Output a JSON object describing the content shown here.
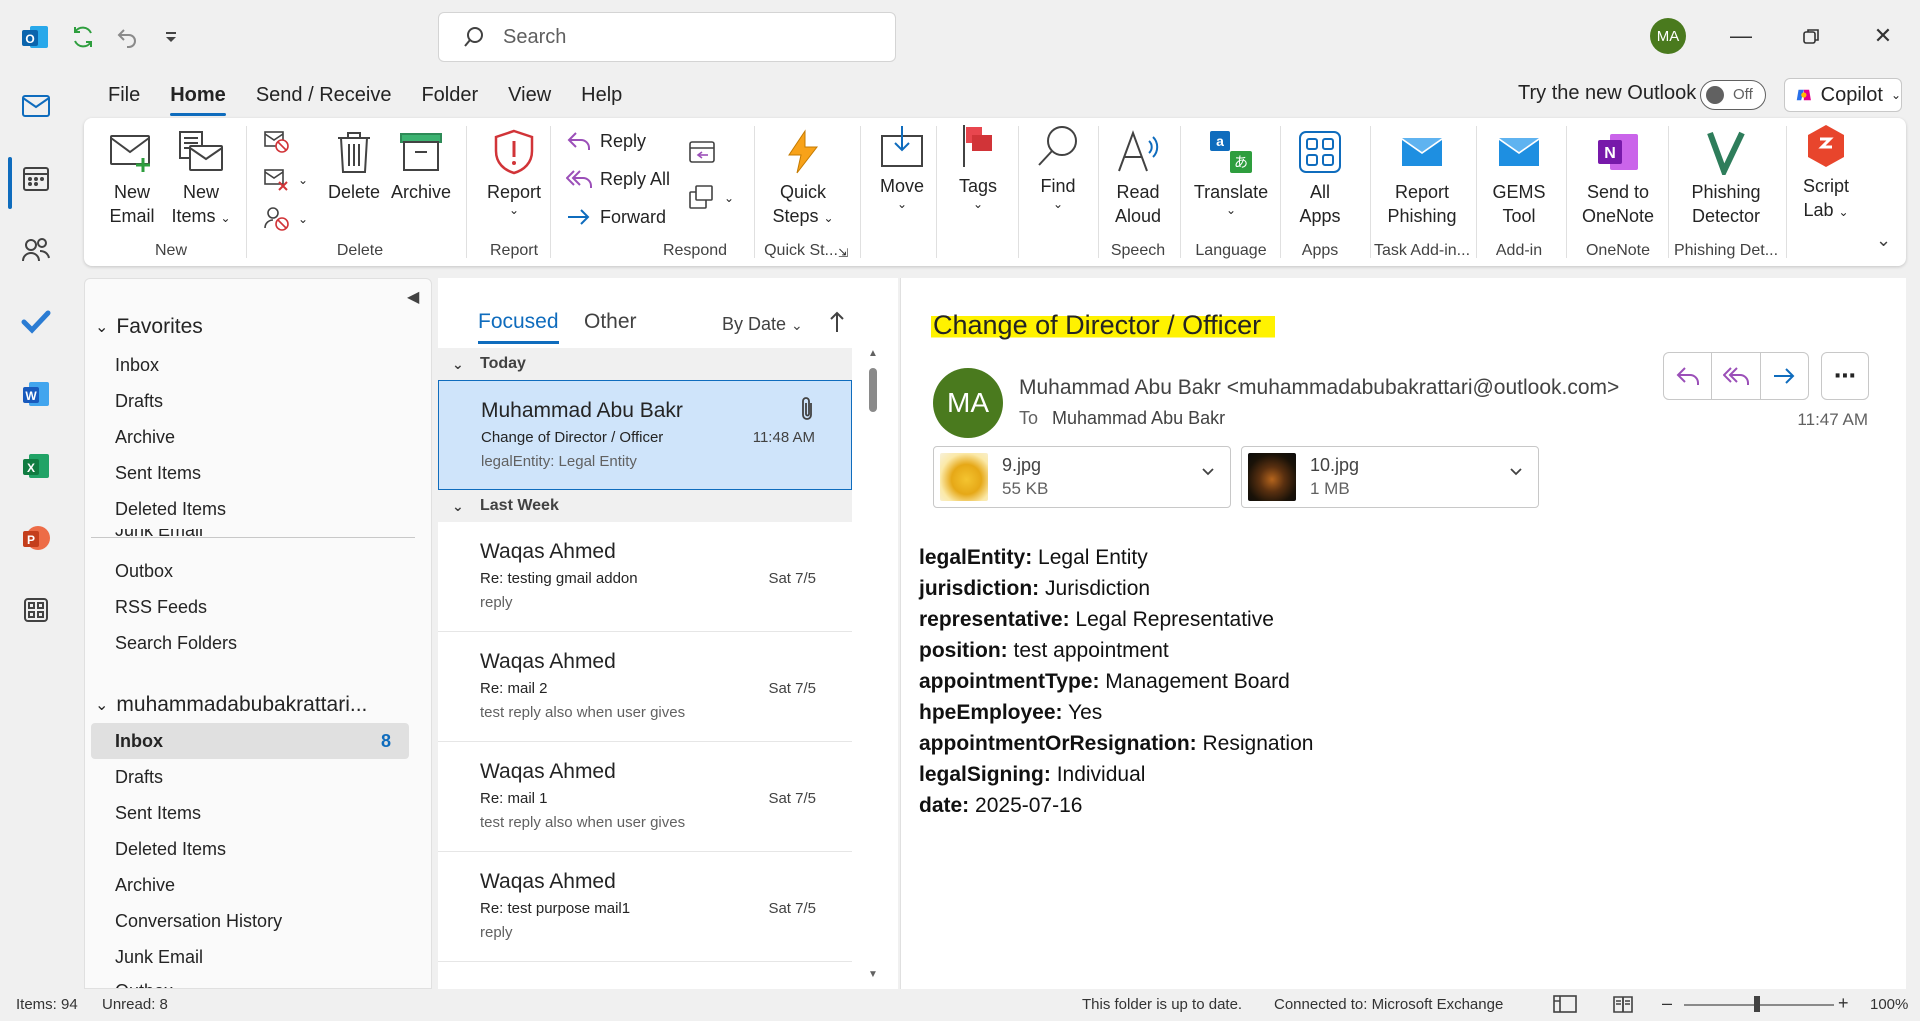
{
  "search": {
    "placeholder": "Search"
  },
  "user": {
    "initials": "MA"
  },
  "menu": {
    "tabs": [
      "File",
      "Home",
      "Send / Receive",
      "Folder",
      "View",
      "Help"
    ],
    "active_tab": "Home",
    "try_new": "Try the new Outlook",
    "toggle_label": "Off",
    "copilot": "Copilot"
  },
  "ribbon": {
    "new_email": [
      "New",
      "Email"
    ],
    "new_items": [
      "New",
      "Items"
    ],
    "delete": "Delete",
    "archive": "Archive",
    "report": "Report",
    "reply": "Reply",
    "reply_all": "Reply All",
    "forward": "Forward",
    "quick_steps": [
      "Quick",
      "Steps"
    ],
    "move": "Move",
    "tags": "Tags",
    "find": "Find",
    "read_aloud": [
      "Read",
      "Aloud"
    ],
    "translate": "Translate",
    "all_apps": [
      "All",
      "Apps"
    ],
    "report_phishing": [
      "Report",
      "Phishing"
    ],
    "gems_tool": [
      "GEMS",
      "Tool"
    ],
    "send_onenote": [
      "Send to",
      "OneNote"
    ],
    "phishing_detector": [
      "Phishing",
      "Detector"
    ],
    "script_lab": [
      "Script",
      "Lab"
    ],
    "groups": {
      "new": "New",
      "delete": "Delete",
      "report": "Report",
      "respond": "Respond",
      "quick_steps": "Quick St...",
      "speech": "Speech",
      "language": "Language",
      "apps": "Apps",
      "task_addin": "Task Add-in...",
      "addin": "Add-in",
      "onenote": "OneNote",
      "phishing_det": "Phishing Det..."
    }
  },
  "folders": {
    "favorites_header": "Favorites",
    "favorites": [
      "Inbox",
      "Drafts",
      "Archive",
      "Sent Items",
      "Deleted Items"
    ],
    "clipped": "Junk Email",
    "extra": [
      "Outbox",
      "RSS Feeds",
      "Search Folders"
    ],
    "account_header": "muhammadabubakrattari...",
    "account_items": [
      "Inbox",
      "Drafts",
      "Sent Items",
      "Deleted Items",
      "Archive",
      "Conversation History",
      "Junk Email"
    ],
    "account_clipped": "Outbox",
    "inbox_count": "8"
  },
  "list": {
    "tab_focused": "Focused",
    "tab_other": "Other",
    "sort": "By Date",
    "group_today": "Today",
    "group_last_week": "Last Week",
    "messages": [
      {
        "sender": "Muhammad Abu Bakr",
        "subject": "Change of Director / Officer",
        "preview": "legalEntity: Legal Entity",
        "date": "11:48 AM"
      },
      {
        "sender": "Waqas Ahmed",
        "subject": "Re: testing gmail addon",
        "preview": "reply",
        "date": "Sat 7/5"
      },
      {
        "sender": "Waqas Ahmed",
        "subject": "Re: mail 2",
        "preview": "test reply also when user gives",
        "date": "Sat 7/5"
      },
      {
        "sender": "Waqas Ahmed",
        "subject": "Re: mail 1",
        "preview": "test reply also when user gives",
        "date": "Sat 7/5"
      },
      {
        "sender": "Waqas Ahmed",
        "subject": "Re: test purpose mail1",
        "preview": "reply",
        "date": "Sat 7/5"
      }
    ]
  },
  "reading": {
    "subject": "Change of Director / Officer",
    "avatar": "MA",
    "from": "Muhammad Abu Bakr <muhammadabubakrattari@outlook.com>",
    "to_label": "To",
    "to": "Muhammad Abu Bakr",
    "time": "11:47 AM",
    "attachments": [
      {
        "name": "9.jpg",
        "size": "55 KB"
      },
      {
        "name": "10.jpg",
        "size": "1 MB"
      }
    ],
    "fields": [
      {
        "key": "legalEntity:",
        "value": "Legal Entity"
      },
      {
        "key": "jurisdiction:",
        "value": "Jurisdiction"
      },
      {
        "key": "representative:",
        "value": "Legal Representative"
      },
      {
        "key": "position:",
        "value": "test appointment"
      },
      {
        "key": "appointmentType:",
        "value": "Management Board"
      },
      {
        "key": "hpeEmployee:",
        "value": "Yes"
      },
      {
        "key": "appointmentOrResignation:",
        "value": "Resignation"
      },
      {
        "key": "legalSigning:",
        "value": "Individual"
      },
      {
        "key": "date:",
        "value": "2025-07-16"
      }
    ]
  },
  "status": {
    "items": "Items: 94",
    "unread": "Unread: 8",
    "sync": "This folder is up to date.",
    "connected": "Connected to: Microsoft Exchange",
    "zoom": "100%"
  },
  "colors": {
    "accent": "#0f6cbd",
    "avatar": "#4a7a1e",
    "highlight": "#fff200",
    "selected": "#cfe4fa"
  }
}
